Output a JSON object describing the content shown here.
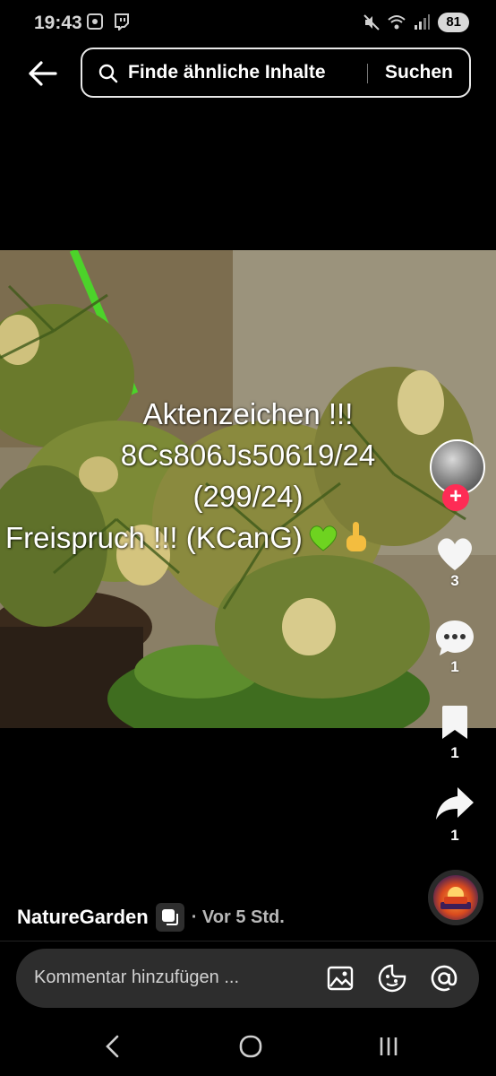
{
  "status_bar": {
    "time": "19:43",
    "battery": "81",
    "icons": [
      "screenshot-icon",
      "twitch-icon",
      "mute-icon",
      "wifi-icon",
      "signal-icon"
    ]
  },
  "search": {
    "query": "Finde ähnliche Inhalte",
    "button_label": "Suchen"
  },
  "video": {
    "caption_lines": [
      "Aktenzeichen !!!",
      "8Cs806Js50619/24",
      "(299/24)",
      "Freispruch !!! (KCanG)"
    ],
    "caption_emojis": [
      "green-heart-icon",
      "pointing-up-hand-icon"
    ]
  },
  "rail": {
    "likes": "3",
    "comments": "1",
    "saves": "1",
    "shares": "1",
    "follow_label": "+"
  },
  "author": {
    "name": "NatureGarden",
    "time": "· Vor 5 Std."
  },
  "comment_bar": {
    "placeholder": "Kommentar hinzufügen ..."
  },
  "colors": {
    "follow": "#fe2c55",
    "background": "#000000",
    "comment_bar": "#2d2d2d"
  }
}
